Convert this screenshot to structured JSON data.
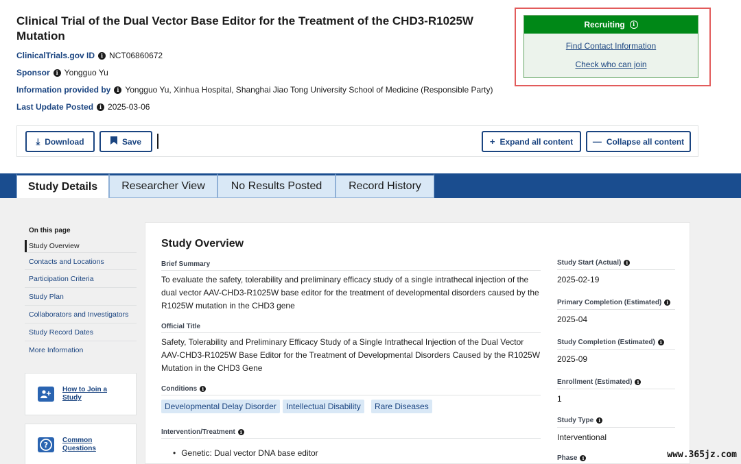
{
  "header": {
    "title": "Clinical Trial of the Dual Vector Base Editor for the Treatment of the CHD3-R1025W Mutation",
    "meta": [
      {
        "label": "ClinicalTrials.gov ID",
        "value": "NCT06860672"
      },
      {
        "label": "Sponsor",
        "value": "Yongguo Yu"
      },
      {
        "label": "Information provided by",
        "value": "Yongguo Yu, Xinhua Hospital, Shanghai Jiao Tong University School of Medicine (Responsible Party)"
      },
      {
        "label": "Last Update Posted",
        "value": "2025-03-06"
      }
    ]
  },
  "recruit": {
    "status": "Recruiting",
    "link_contact": "Find Contact Information",
    "link_join": "Check who can join",
    "colors": {
      "status_bg": "#008817",
      "panel_bg": "#ecf3ec",
      "highlight": "#e25b5b"
    }
  },
  "toolbar": {
    "download": "Download",
    "save": "Save",
    "expand": "Expand all content",
    "collapse": "Collapse all content"
  },
  "tabs": [
    "Study Details",
    "Researcher View",
    "No Results Posted",
    "Record History"
  ],
  "onpage": {
    "title": "On this page",
    "items": [
      "Study Overview",
      "Contacts and Locations",
      "Participation Criteria",
      "Study Plan",
      "Collaborators and Investigators",
      "Study Record Dates",
      "More Information"
    ]
  },
  "side_cards": [
    {
      "icon": "add-person-icon",
      "label_1": "How to Join a",
      "label_2": "Study"
    },
    {
      "icon": "question-icon",
      "label_1": "Common",
      "label_2": "Questions"
    }
  ],
  "overview": {
    "title": "Study Overview",
    "brief_summary_label": "Brief Summary",
    "brief_summary": "To evaluate the safety, tolerability and preliminary efficacy study of a single intrathecal injection of the dual vector AAV-CHD3-R1025W base editor for the treatment of developmental disorders caused by the R1025W mutation in the CHD3 gene",
    "official_title_label": "Official Title",
    "official_title": "Safety, Tolerability and Preliminary Efficacy Study of a Single Intrathecal Injection of the Dual Vector AAV-CHD3-R1025W Base Editor for the Treatment of Developmental Disorders Caused by the R1025W Mutation in the CHD3 Gene",
    "conditions_label": "Conditions",
    "conditions": [
      "Developmental Delay Disorder",
      "Intellectual Disability",
      "Rare Diseases"
    ],
    "intervention_label": "Intervention/Treatment",
    "intervention": "Genetic: Dual vector DNA base editor"
  },
  "facts": [
    {
      "label": "Study Start (Actual)",
      "value": "2025-02-19"
    },
    {
      "label": "Primary Completion (Estimated)",
      "value": "2025-04"
    },
    {
      "label": "Study Completion (Estimated)",
      "value": "2025-09"
    },
    {
      "label": "Enrollment (Estimated)",
      "value": "1"
    },
    {
      "label": "Study Type",
      "value": "Interventional"
    },
    {
      "label": "Phase",
      "value": ""
    }
  ],
  "watermark": "www.365jz.com"
}
